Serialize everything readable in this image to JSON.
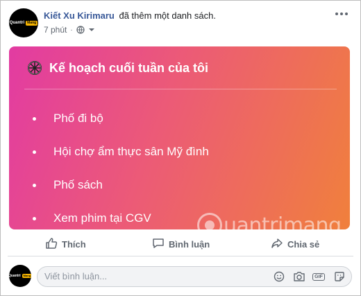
{
  "post": {
    "author": "Kiết Xu Kirimaru",
    "action_text": "đã thêm một danh sách.",
    "timestamp": "7 phút",
    "separator": "·",
    "avatar_text_a": "Quantri",
    "avatar_text_b": "Mang"
  },
  "card": {
    "title": "Kế hoạch cuối tuần của tôi",
    "items": [
      "Phố đi bộ",
      "Hội chợ ẩm thực sân Mỹ đình",
      "Phố sách",
      "Xem phim tại CGV"
    ],
    "gradient": [
      "#e23ba2",
      "#ec5b76",
      "#f0803c"
    ]
  },
  "watermark": {
    "text": "uantrimang"
  },
  "actions": {
    "like_label": "Thích",
    "comment_label": "Bình luận",
    "share_label": "Chia sẻ"
  },
  "comment_box": {
    "placeholder": "Viết bình luận...",
    "value": ""
  },
  "icons": [
    "globe-icon",
    "chevron-down-icon",
    "more-icon",
    "wheel-icon",
    "like-icon",
    "comment-icon",
    "share-icon",
    "emoji-icon",
    "camera-icon",
    "gif-icon",
    "sticker-icon"
  ],
  "colors": {
    "author": "#385898",
    "muted": "#606770"
  }
}
